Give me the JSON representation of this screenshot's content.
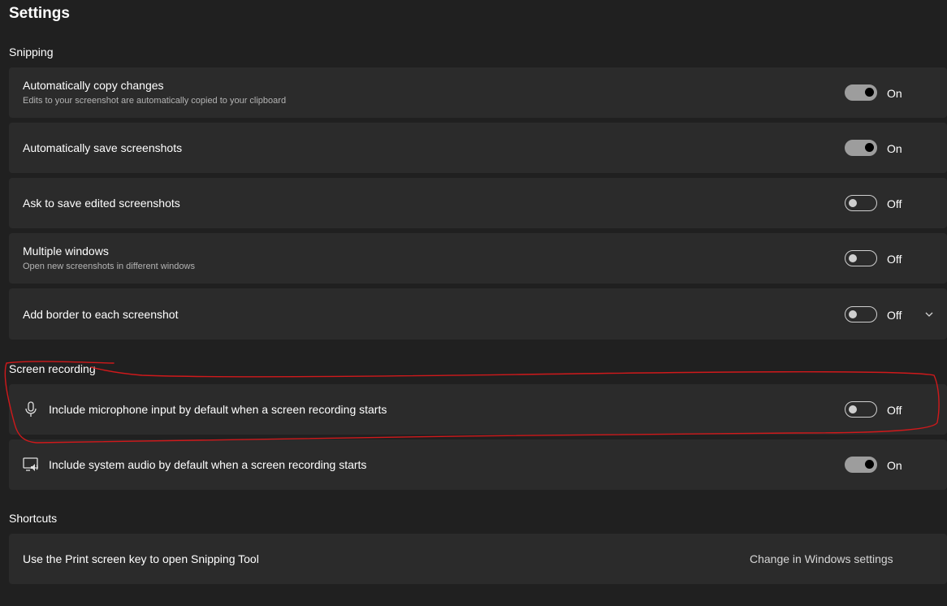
{
  "page": {
    "title": "Settings"
  },
  "sections": {
    "snipping": {
      "header": "Snipping",
      "rows": [
        {
          "title": "Automatically copy changes",
          "description": "Edits to your screenshot are automatically copied to your clipboard",
          "state": "On"
        },
        {
          "title": "Automatically save screenshots",
          "state": "On"
        },
        {
          "title": "Ask to save edited screenshots",
          "state": "Off"
        },
        {
          "title": "Multiple windows",
          "description": "Open new screenshots in different windows",
          "state": "Off"
        },
        {
          "title": "Add border to each screenshot",
          "state": "Off"
        }
      ]
    },
    "screen_recording": {
      "header": "Screen recording",
      "rows": [
        {
          "title": "Include microphone input by default when a screen recording starts",
          "icon": "microphone-icon",
          "state": "Off"
        },
        {
          "title": "Include system audio by default when a screen recording starts",
          "icon": "system-audio-icon",
          "state": "On"
        }
      ]
    },
    "shortcuts": {
      "header": "Shortcuts",
      "rows": [
        {
          "title": "Use the Print screen key to open Snipping Tool",
          "link": "Change in Windows settings"
        }
      ]
    }
  },
  "colors": {
    "background": "#202020",
    "card": "#2b2b2b",
    "annotation": "#d0191b"
  }
}
